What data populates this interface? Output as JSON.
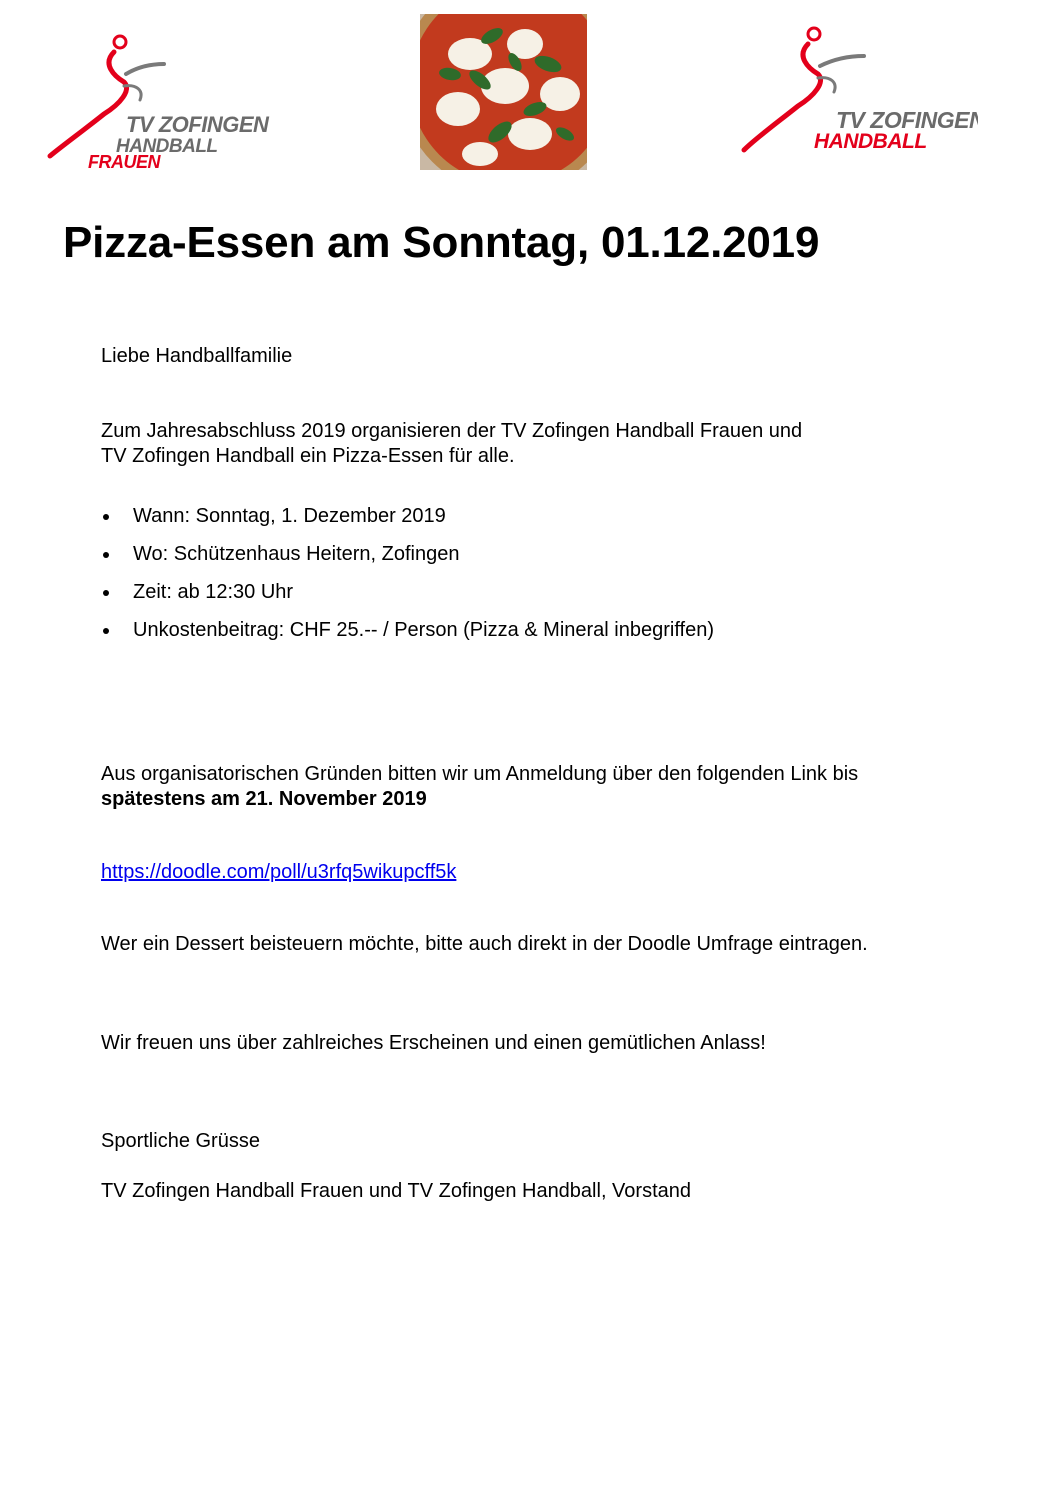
{
  "logos": {
    "left": {
      "line1": "TV ZOFINGEN",
      "line2": "HANDBALL",
      "line3": "FRAUEN"
    },
    "right": {
      "line1": "TV ZOFINGEN",
      "line2": "HANDBALL"
    },
    "colors": {
      "red": "#e3001b",
      "gray": "#6b6b6b"
    }
  },
  "title": "Pizza-Essen am Sonntag, 01.12.2019",
  "greeting": "Liebe Handballfamilie",
  "intro": {
    "line1": "Zum Jahresabschluss 2019 organisieren der TV Zofingen Handball Frauen und",
    "line2": "TV Zofingen Handball ein Pizza-Essen für alle."
  },
  "details": [
    "Wann: Sonntag, 1. Dezember 2019",
    "Wo: Schützenhaus Heitern, Zofingen",
    "Zeit: ab 12:30 Uhr",
    "Unkostenbeitrag: CHF 25.-- / Person (Pizza & Mineral inbegriffen)"
  ],
  "registration": {
    "line1": "Aus organisatorischen Gründen bitten wir um Anmeldung über den folgenden Link bis",
    "deadline": "spätestens am 21. November 2019"
  },
  "link": "https://doodle.com/poll/u3rfq5wikupcff5k",
  "dessert": "Wer ein Dessert beisteuern möchte, bitte auch direkt in der Doodle Umfrage eintragen.",
  "closing": "Wir freuen uns über zahlreiches Erscheinen und einen gemütlichen Anlass!",
  "regards": "Sportliche Grüsse",
  "signature": "TV Zofingen Handball Frauen und TV Zofingen Handball, Vorstand"
}
